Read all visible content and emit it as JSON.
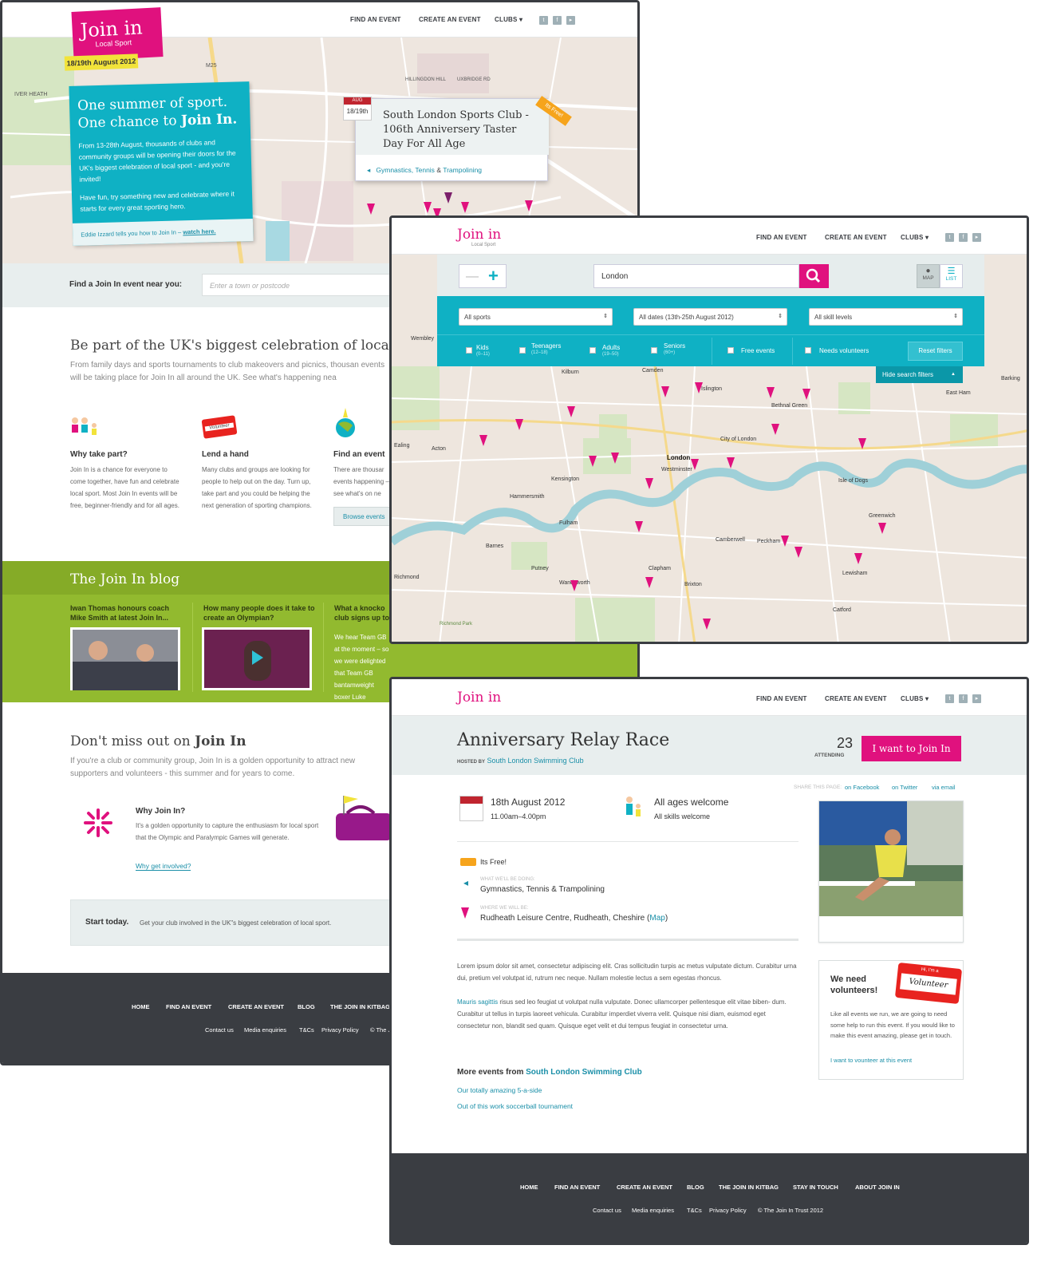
{
  "brand": {
    "logo": "Join in",
    "logo_sub": "Local Sport",
    "colors": {
      "pink": "#e0117e",
      "teal": "#0fb1c4",
      "green": "#92ba2f",
      "dark": "#3a3d42"
    }
  },
  "nav": {
    "find": "FIND AN EVENT",
    "create": "CREATE AN EVENT",
    "clubs": "CLUBS"
  },
  "home": {
    "date_badge": "18/19th August 2012",
    "map_labels": [
      "IVER HEATH",
      "M25",
      "HILLINGDON HILL",
      "UXBRIDGE RD",
      "FRANCIS RD",
      "HIGH RD",
      "PARK RD",
      "CHARVILLE LN"
    ],
    "hero_title_1": "One summer of sport.",
    "hero_title_2a": "One chance to ",
    "hero_title_2b": "Join In.",
    "hero_p1": "From 13-28th August, thousands of clubs and community groups will be opening their doors for the UK's biggest celebration of local sport - and you're invited!",
    "hero_p2": "Have fun, try something new and celebrate where it starts for every great sporting hero.",
    "hero_link_pre": "Eddie Izzard tells you how to Join In – ",
    "hero_link": "watch here.",
    "popup": {
      "month": "AUG",
      "day": "18/19th",
      "title": "South London Sports Club - 106th Anniversery Taster Day For All Age",
      "tag": "Its Free!",
      "s1": "Gymnastics",
      "s2": "Tennis",
      "amp": "&",
      "s3": "Trampolining"
    },
    "find_label": "Find a Join In event near you:",
    "find_placeholder": "Enter a town or postcode",
    "celebrate_title": "Be part of the UK's biggest celebration of local sp",
    "celebrate_text": "From family days and sports tournaments to club makeovers and picnics, thousan events will be taking place for Join In all around the UK. See what's happening nea",
    "cols": [
      {
        "title": "Why take part?",
        "text": "Join In is a chance for everyone to come together, have fun and celebrate local sport. Most Join In events will be free, beginner-friendly and for all ages."
      },
      {
        "title": "Lend a hand",
        "text": "Many clubs and groups are looking for people to help out on the day. Turn up, take part and you could be helping the next generation of sporting champions."
      },
      {
        "title": "Find an event",
        "text": "There are thousar events happening – see what's on ne",
        "button": "Browse events"
      }
    ],
    "volunteer_badge": "Volunteer",
    "blog_title": "The Join In blog",
    "blog": [
      {
        "title": "Iwan Thomas honours coach Mike Smith at latest Join In..."
      },
      {
        "title": "How many people does it take to create an Olympian?"
      },
      {
        "title": "What a knocko club signs up to",
        "text": "We hear Team GB at the moment – so we were delighted that Team GB bantamweight boxer Luke Campbell decided"
      }
    ],
    "dontmiss_title_a": "Don't miss out on ",
    "dontmiss_title_b": "Join In",
    "dontmiss_text": "If you're a club or community group, Join In is a golden opportunity to attract new supporters and volunteers - this summer and for years to come.",
    "why_title": "Why Join In?",
    "why_text": "It's a golden opportunity to capture the enthusiasm for local sport that the Olympic and Paralympic Games will generate.",
    "why_link": "Why get involved?",
    "start_bold": "Start today.",
    "start_text": "Get your club involved in the UK\"s biggest celebration of local sport.",
    "footer_nav": [
      "HOME",
      "FIND AN EVENT",
      "CREATE AN EVENT",
      "BLOG",
      "THE JOIN IN KITBAG"
    ],
    "footer_sub": [
      "Contact us",
      "Media enquiries",
      "T&Cs",
      "Privacy Policy",
      "© The J"
    ]
  },
  "map_page": {
    "search_value": "London",
    "toggle_map": "MAP",
    "toggle_list": "LIST",
    "selects": [
      "All sports",
      "All dates (13th-25th August 2012)",
      "All skill levels"
    ],
    "filters": [
      {
        "label": "Kids",
        "sub": "(0–11)"
      },
      {
        "label": "Teenagers",
        "sub": "(12–18)"
      },
      {
        "label": "Adults",
        "sub": "(19–50)"
      },
      {
        "label": "Seniors",
        "sub": "(60+)"
      }
    ],
    "free_events": "Free events",
    "needs_vol": "Needs volunteers",
    "reset": "Reset filters",
    "hide_filters": "Hide search filters",
    "places": [
      "Kilburn",
      "Camden",
      "Islington",
      "Bethnal Green",
      "East Ham",
      "Barking",
      "Ealing",
      "Acton",
      "City of London",
      "London",
      "Westminster",
      "Kensington",
      "Hammersmith",
      "Isle of Dogs",
      "Greenwich",
      "Fulham",
      "Camberwell",
      "Peckham",
      "Barnes",
      "Putney",
      "Clapham",
      "Brixton",
      "Lewisham",
      "Wandsworth",
      "Richmond",
      "Catford",
      "Wembley",
      "Richmond Park"
    ],
    "roads": [
      "A406",
      "A40",
      "A501",
      "A11",
      "A13",
      "A117",
      "A4",
      "A202",
      "A3220",
      "A316",
      "A3",
      "A205",
      "A2",
      "A21",
      "A23",
      "A102",
      "A1",
      "A205"
    ]
  },
  "event_page": {
    "title": "Anniversary Relay Race",
    "hosted_by_label": "HOSTED BY",
    "host": "South London Swimming Club",
    "attending_count": "23",
    "attending_label": "ATTENDING",
    "join_button": "I want to Join In",
    "share_label": "SHARE THIS PAGE:",
    "share": [
      "on Facebook",
      "on Twitter",
      "via email"
    ],
    "date": "18th August 2012",
    "time": "11.00am–4.00pm",
    "ages": "All ages welcome",
    "skills": "All skills welcome",
    "free": "Its Free!",
    "doing_label": "WHAT WE'LL BE DOING:",
    "doing": "Gymnastics, Tennis & Trampolining",
    "where_label": "WHERE WE WILL BE:",
    "where": "Rudheath Leisure Centre, Rudheath, Cheshire (",
    "where_map": "Map",
    "where_end": ")",
    "lorem1": "Lorem ipsum dolor sit amet, consectetur adipiscing elit. Cras sollicitudin turpis ac metus vulputate dictum. Curabitur urna dui, pretium vel volutpat id, rutrum nec neque. Nullam molestie lectus a sem egestas rhoncus.",
    "lorem2_link": "Mauris sagittis",
    "lorem2": " risus sed leo feugiat ut volutpat nulla vulputate. Donec ullamcorper pellentesque elit vitae biben- dum. Curabitur ut tellus in turpis laoreet vehicula. Curabitur imperdiet viverra velit. Quisque nisi diam, euismod eget consectetur non, blandit sed quam. Quisque eget velit et dui tempus feugiat in consectetur urna.",
    "more_from": "More events from ",
    "more_links": [
      "Our totally amazing 5-a-side",
      "Out of this work soccerball tournament"
    ],
    "need_vol_title": "We need volunteers!",
    "badge_hi": "Hi, I'm a",
    "badge_vol": "Volunteer",
    "need_vol_text": "Like all events we run, we are going to need some help to run this event. If you would like to make this event amazing, please get in touch.",
    "need_vol_link": "I want to vounteer at this event",
    "footer_nav": [
      "HOME",
      "FIND AN EVENT",
      "CREATE AN EVENT",
      "BLOG",
      "THE JOIN IN KITBAG",
      "STAY IN TOUCH",
      "ABOUT JOIN IN"
    ],
    "footer_sub": [
      "Contact us",
      "Media enquiries",
      "T&Cs",
      "Privacy Policy",
      "© The Join In Trust 2012"
    ]
  }
}
